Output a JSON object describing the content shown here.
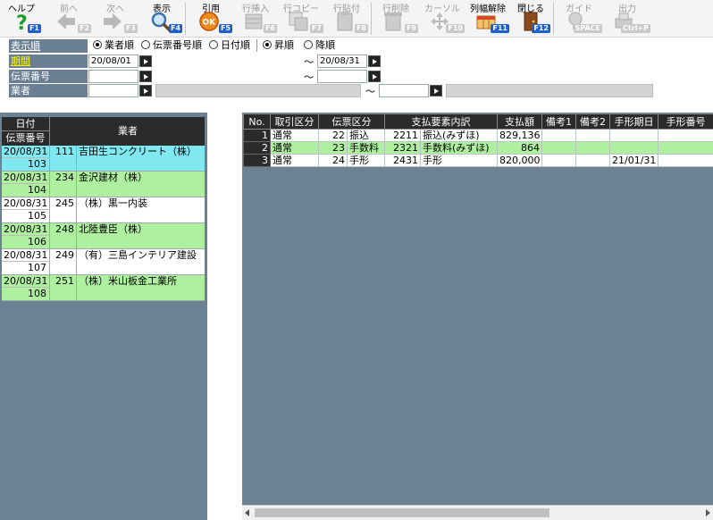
{
  "toolbar": {
    "buttons": [
      {
        "label": "ヘルプ",
        "key": "F1",
        "icon": "help-icon"
      },
      {
        "label": "前へ",
        "key": "F2",
        "icon": "arrow-left-icon"
      },
      {
        "label": "次へ",
        "key": "F3",
        "icon": "arrow-right-icon"
      },
      {
        "label": "表示",
        "key": "F4",
        "icon": "magnifier-icon"
      },
      {
        "label": "引用",
        "key": "F5",
        "icon": "ok-stamp-icon"
      },
      {
        "label": "行挿入",
        "key": "F6",
        "icon": "row-insert-icon"
      },
      {
        "label": "行コピー",
        "key": "F7",
        "icon": "row-copy-icon"
      },
      {
        "label": "行貼付",
        "key": "F8",
        "icon": "row-paste-icon"
      },
      {
        "label": "行削除",
        "key": "F9",
        "icon": "row-delete-icon"
      },
      {
        "label": "カーソル",
        "key": "F10",
        "icon": "cursor-icon"
      },
      {
        "label": "列幅解除",
        "key": "F11",
        "icon": "column-width-icon"
      },
      {
        "label": "閉じる",
        "key": "F12",
        "icon": "door-icon"
      },
      {
        "label": "ガイド",
        "key": "SPACE",
        "icon": "lightbulb-icon"
      },
      {
        "label": "出力",
        "key": "Ctrl+P",
        "icon": "printer-icon"
      }
    ]
  },
  "filter": {
    "sort_label": "表示順",
    "sort_options": [
      "業者順",
      "伝票番号順",
      "日付順"
    ],
    "order_options": [
      "昇順",
      "降順"
    ],
    "period_label": "期間",
    "period_from": "20/08/01",
    "period_to": "20/08/31",
    "tilde": "～",
    "slip_label": "伝票番号",
    "vendor_label": "業者"
  },
  "left": {
    "header_date": "日付",
    "header_slip": "伝票番号",
    "header_vendor": "業者",
    "rows": [
      {
        "date": "20/08/31",
        "slip": "103",
        "no": "111",
        "name": "吉田生コンクリート（株）"
      },
      {
        "date": "20/08/31",
        "slip": "104",
        "no": "234",
        "name": "金沢建材（株）"
      },
      {
        "date": "20/08/31",
        "slip": "105",
        "no": "245",
        "name": "（株）黒一内装"
      },
      {
        "date": "20/08/31",
        "slip": "106",
        "no": "248",
        "name": "北陸豊臣（株）"
      },
      {
        "date": "20/08/31",
        "slip": "107",
        "no": "249",
        "name": "（有）三島インテリア建設"
      },
      {
        "date": "20/08/31",
        "slip": "108",
        "no": "251",
        "name": "（株）米山板金工業所"
      }
    ]
  },
  "right": {
    "columns": [
      "No.",
      "取引区分",
      "伝票区分",
      "支払要素内訳",
      "支払額",
      "備考1",
      "備考2",
      "手形期日",
      "手形番号"
    ],
    "rows": [
      {
        "no": "1",
        "kind": "通常",
        "code": "22",
        "cat": "振込",
        "detail_code": "2211",
        "detail": "振込(みずほ)",
        "amount": "829,136",
        "memo1": "",
        "memo2": "",
        "due": "",
        "bill": ""
      },
      {
        "no": "2",
        "kind": "通常",
        "code": "23",
        "cat": "手数料",
        "detail_code": "2321",
        "detail": "手数料(みずほ)",
        "amount": "864",
        "memo1": "",
        "memo2": "",
        "due": "",
        "bill": ""
      },
      {
        "no": "3",
        "kind": "通常",
        "code": "24",
        "cat": "手形",
        "detail_code": "2431",
        "detail": "手形",
        "amount": "820,000",
        "memo1": "",
        "memo2": "",
        "due": "21/01/31",
        "bill": ""
      }
    ]
  },
  "colors": {
    "panel": "#6b8194",
    "selected": "#80e8f0",
    "green": "#aef0a0",
    "header": "#2b2b2b",
    "fkey": "#1c5fd0"
  }
}
